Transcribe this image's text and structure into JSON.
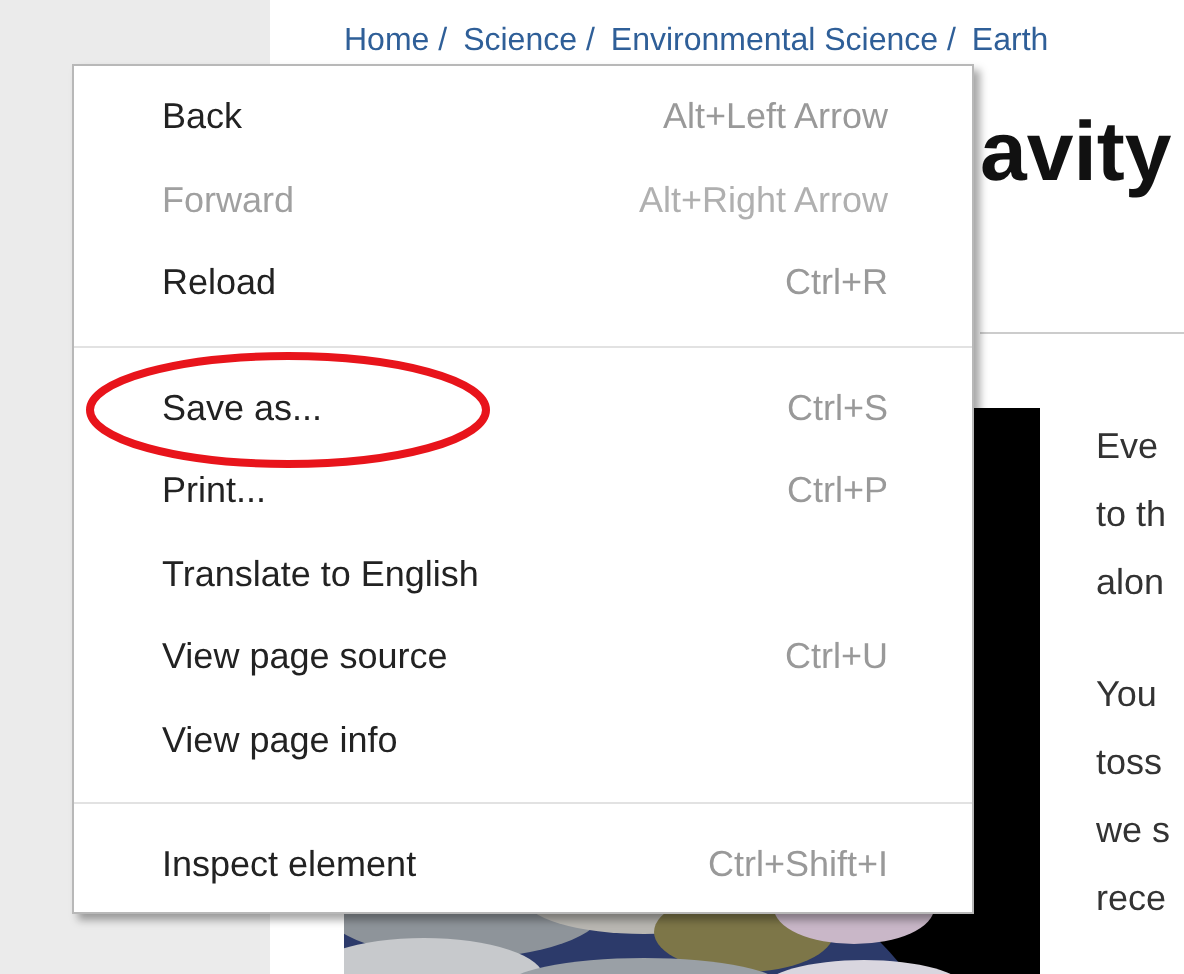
{
  "breadcrumb": [
    "Home /",
    "Science /",
    "Environmental Science /",
    "Earth"
  ],
  "title": "avity",
  "article": {
    "paragraphs": [
      {
        "lines": [
          "Eve",
          "to th",
          "alon"
        ]
      },
      {
        "lines": [
          "You",
          "toss",
          "we s",
          "rece"
        ]
      }
    ]
  },
  "context_menu": {
    "items": [
      {
        "kind": "item",
        "label": "Back",
        "shortcut": "Alt+Left Arrow",
        "disabled": false,
        "circled": false
      },
      {
        "kind": "item",
        "label": "Forward",
        "shortcut": "Alt+Right Arrow",
        "disabled": true,
        "circled": false
      },
      {
        "kind": "item",
        "label": "Reload",
        "shortcut": "Ctrl+R",
        "disabled": false,
        "circled": false
      },
      {
        "kind": "separator"
      },
      {
        "kind": "item",
        "label": "Save as...",
        "shortcut": "Ctrl+S",
        "disabled": false,
        "circled": true
      },
      {
        "kind": "item",
        "label": "Print...",
        "shortcut": "Ctrl+P",
        "disabled": false,
        "circled": false
      },
      {
        "kind": "item",
        "label": "Translate to English",
        "disabled": false,
        "circled": false
      },
      {
        "kind": "item",
        "label": "View page source",
        "shortcut": "Ctrl+U",
        "disabled": false,
        "circled": false
      },
      {
        "kind": "item",
        "label": "View page info",
        "disabled": false,
        "circled": false
      },
      {
        "kind": "separator"
      },
      {
        "kind": "item",
        "label": "Inspect element",
        "shortcut": "Ctrl+Shift+I",
        "disabled": false,
        "circled": false
      }
    ]
  }
}
